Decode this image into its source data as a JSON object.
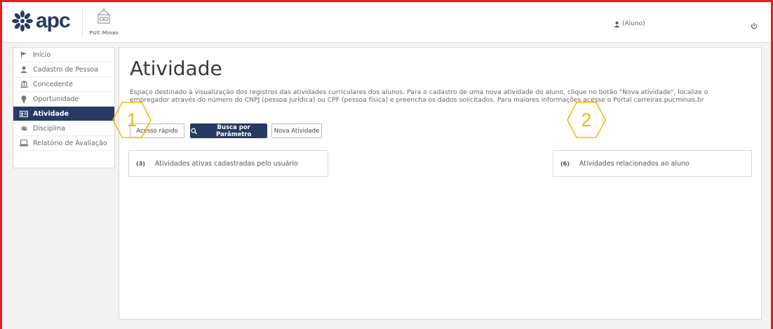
{
  "header": {
    "logo_text": "apc",
    "institution": "PUC Minas",
    "user": "(Aluno)"
  },
  "sidebar": {
    "items": [
      {
        "label": "Início",
        "icon": "flag-icon"
      },
      {
        "label": "Cadastro de Pessoa",
        "icon": "user-icon"
      },
      {
        "label": "Concedente",
        "icon": "bank-icon"
      },
      {
        "label": "Oportunidade",
        "icon": "lightbulb-icon"
      },
      {
        "label": "Atividade",
        "icon": "id-card-icon",
        "active": true
      },
      {
        "label": "Disciplina",
        "icon": "books-icon"
      },
      {
        "label": "Relatório de Avaliação",
        "icon": "laptop-icon"
      }
    ]
  },
  "main": {
    "title": "Atividade",
    "description": "Espaço destinado à visualização dos registros das atividades curriculares dos alunos. Para o cadastro de uma nova atividade do aluno, clique no botão \"Nova atividade\", localize o empregador através do número do CNPJ (pessoa jurídica) ou CPF (pessoa física) e preencha os dados solicitados. Para maiores informações acesse o Portal carreiras.pucminas.br",
    "buttons": {
      "quick_access": "Acesso rápido",
      "search_param": "Busca por Parâmetro",
      "new_activity": "Nova Atividade"
    },
    "cards": [
      {
        "count": "(3)",
        "label": "Atividades ativas cadastradas pelo usuário"
      },
      {
        "count": "(6)",
        "label": "Atividades relacionados ao aluno"
      }
    ]
  },
  "callouts": [
    "1",
    "2"
  ],
  "colors": {
    "brand": "#283a63",
    "frame": "#e41e1e",
    "callout": "#f5b800"
  }
}
